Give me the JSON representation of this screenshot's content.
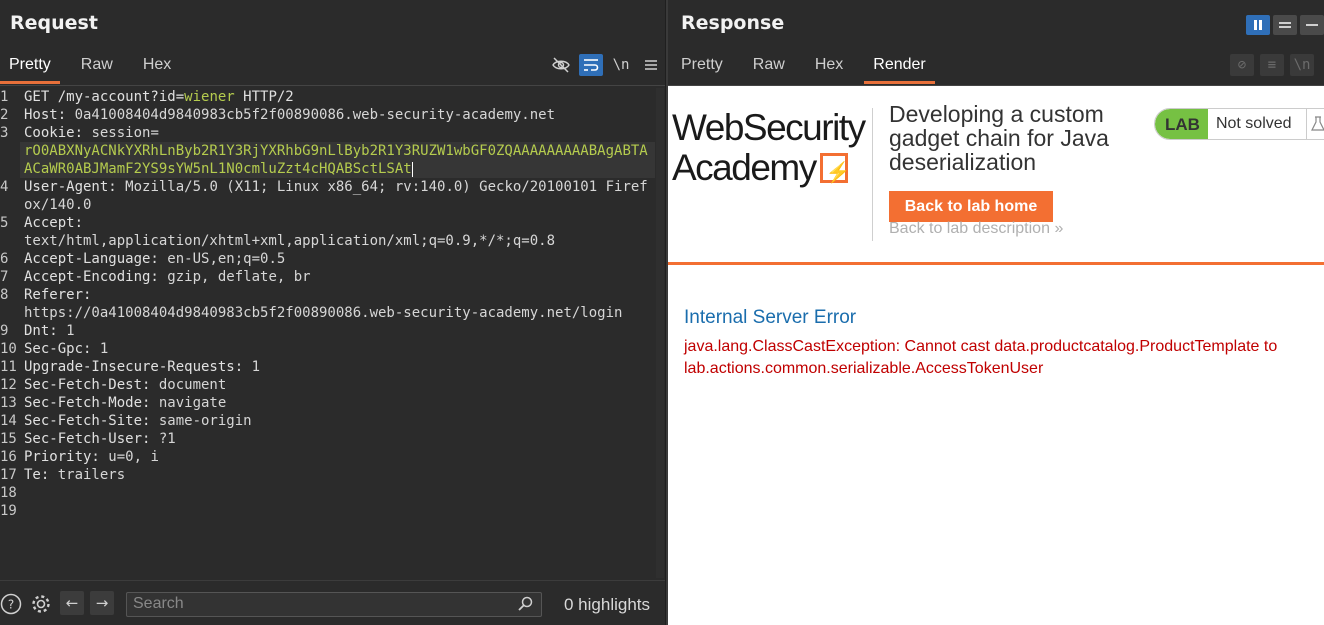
{
  "request": {
    "title": "Request",
    "tabs": [
      "Pretty",
      "Raw",
      "Hex"
    ],
    "active_tab": "Pretty",
    "toolbar": {
      "newline_label": "\\n"
    },
    "lines": [
      {
        "n": "1",
        "parts": [
          [
            "k",
            "GET /my-account?id="
          ],
          [
            "g",
            "wiener"
          ],
          [
            "k",
            " HTTP/2"
          ]
        ]
      },
      {
        "n": "2",
        "parts": [
          [
            "k",
            "Host: "
          ],
          [
            "v",
            "0a41008404d9840983cb5f2f00890086.web-security-academy.net"
          ]
        ]
      },
      {
        "n": "3",
        "parts": [
          [
            "k",
            "Cookie: "
          ],
          [
            "v",
            "session="
          ]
        ]
      },
      {
        "n": "",
        "parts": [
          [
            "g",
            "rO0ABXNyACNkYXRhLnByb2R1Y3RjYXRhbG9nLlByb2R1Y3RUZW1wbGF0ZQAAAAAAAAABAgABTAACaWR0ABJMamF2YS9sYW5nL1N0cmluZzt4cHQABSctLSAt"
          ]
        ],
        "cursor": true
      },
      {
        "n": "4",
        "parts": [
          [
            "k",
            "User-Agent: "
          ],
          [
            "v",
            "Mozilla/5.0 (X11; Linux x86_64; rv:140.0) Gecko/20100101 Firefox/140.0"
          ]
        ]
      },
      {
        "n": "5",
        "parts": [
          [
            "k",
            "Accept:"
          ]
        ]
      },
      {
        "n": "",
        "parts": [
          [
            "v",
            "text/html,application/xhtml+xml,application/xml;q=0.9,*/*;q=0.8"
          ]
        ]
      },
      {
        "n": "6",
        "parts": [
          [
            "k",
            "Accept-Language: "
          ],
          [
            "v",
            "en-US,en;q=0.5"
          ]
        ]
      },
      {
        "n": "7",
        "parts": [
          [
            "k",
            "Accept-Encoding: "
          ],
          [
            "v",
            "gzip, deflate, br"
          ]
        ]
      },
      {
        "n": "8",
        "parts": [
          [
            "k",
            "Referer:"
          ]
        ]
      },
      {
        "n": "",
        "parts": [
          [
            "v",
            "https://0a41008404d9840983cb5f2f00890086.web-security-academy.net/login"
          ]
        ]
      },
      {
        "n": "9",
        "parts": [
          [
            "k",
            "Dnt: "
          ],
          [
            "v",
            "1"
          ]
        ]
      },
      {
        "n": "10",
        "parts": [
          [
            "k",
            "Sec-Gpc: "
          ],
          [
            "v",
            "1"
          ]
        ]
      },
      {
        "n": "11",
        "parts": [
          [
            "k",
            "Upgrade-Insecure-Requests: "
          ],
          [
            "v",
            "1"
          ]
        ]
      },
      {
        "n": "12",
        "parts": [
          [
            "k",
            "Sec-Fetch-Dest: "
          ],
          [
            "v",
            "document"
          ]
        ]
      },
      {
        "n": "13",
        "parts": [
          [
            "k",
            "Sec-Fetch-Mode: "
          ],
          [
            "v",
            "navigate"
          ]
        ]
      },
      {
        "n": "14",
        "parts": [
          [
            "k",
            "Sec-Fetch-Site: "
          ],
          [
            "v",
            "same-origin"
          ]
        ]
      },
      {
        "n": "15",
        "parts": [
          [
            "k",
            "Sec-Fetch-User: "
          ],
          [
            "v",
            "?1"
          ]
        ]
      },
      {
        "n": "16",
        "parts": [
          [
            "k",
            "Priority: "
          ],
          [
            "v",
            "u=0, i"
          ]
        ]
      },
      {
        "n": "17",
        "parts": [
          [
            "k",
            "Te: "
          ],
          [
            "v",
            "trailers"
          ]
        ]
      },
      {
        "n": "18",
        "parts": []
      },
      {
        "n": "19",
        "parts": []
      }
    ],
    "search": {
      "placeholder": "Search"
    },
    "highlights": "0 highlights"
  },
  "response": {
    "title": "Response",
    "tabs": [
      "Pretty",
      "Raw",
      "Hex",
      "Render"
    ],
    "active_tab": "Render",
    "render": {
      "logo_line1": "WebSecurity",
      "logo_line2": "Academy",
      "lab_title": "Developing a custom gadget chain for Java deserialization",
      "lab_badge": "LAB",
      "lab_status": "Not solved",
      "back_button": "Back to lab home",
      "back_description": "Back to lab description",
      "error_title": "Internal Server Error",
      "error_message": "java.lang.ClassCastException: Cannot cast data.productcatalog.ProductTemplate to lab.actions.common.serializable.AccessTokenUser"
    }
  },
  "colors": {
    "accent": "#e8703a",
    "brand_orange": "#f36f32",
    "lab_green": "#76c143",
    "error_red": "#c00000",
    "link_blue": "#1a6dad",
    "string_green": "#b5cc4e"
  },
  "icons": [
    "eye-off-icon",
    "wrap-icon",
    "newline-icon",
    "menu-icon",
    "help-icon",
    "settings-icon",
    "arrow-left-icon",
    "arrow-right-icon",
    "search-icon",
    "flask-icon"
  ]
}
